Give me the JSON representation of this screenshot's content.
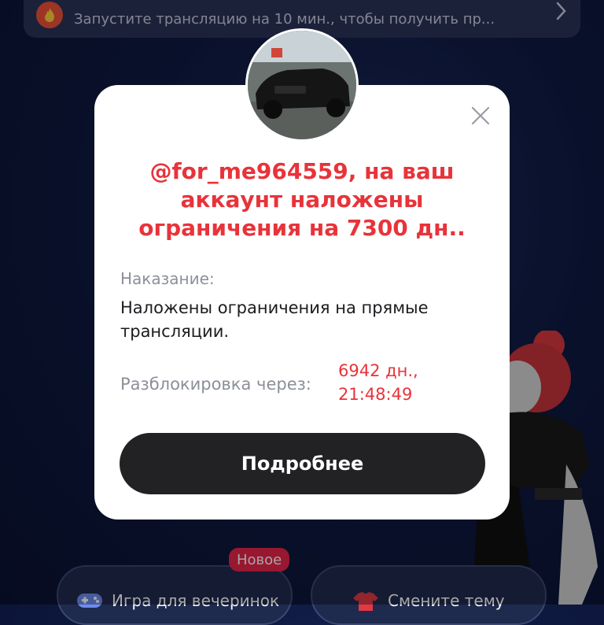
{
  "banner": {
    "text": "Запустите трансляцию на 10 мин., чтобы получить пр...",
    "icon": "fire-icon"
  },
  "modal": {
    "title": "@for_me964559, на ваш аккаунт наложены ограничения на 7300 дн..",
    "punishment_label": "Наказание:",
    "punishment_text": "Наложены ограничения на прямые трансляции.",
    "unlock_label": "Разблокировка через:",
    "unlock_value_days": "6942 дн.,",
    "unlock_value_time": "21:48:49",
    "details_button": "Подробнее",
    "close_icon": "close-icon",
    "title_color": "#e8333a"
  },
  "bottom": {
    "left_pill_label": "Игра для вечеринок",
    "left_pill_icon": "gamepad-icon",
    "new_badge": "Новое",
    "right_pill_label": "Смените тему",
    "right_pill_icon": "shirt-icon"
  }
}
